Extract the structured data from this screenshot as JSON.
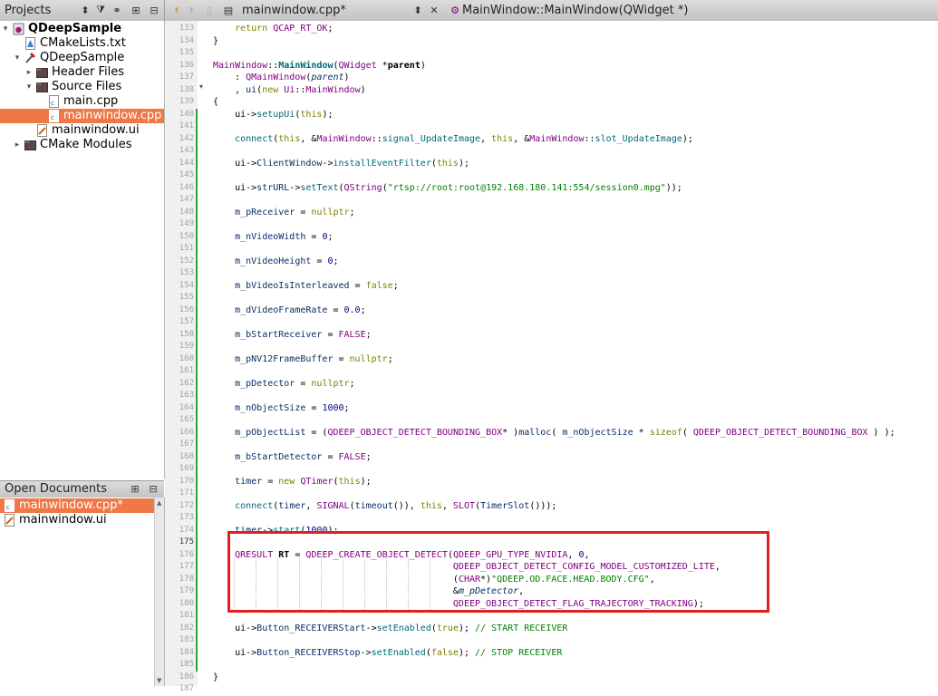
{
  "projects_panel": {
    "title": "Projects"
  },
  "project_tree": [
    {
      "label": "QDeepSample",
      "level": 0,
      "arrow": "▾",
      "icon": "project-icon",
      "bold": true,
      "selected": false
    },
    {
      "label": "CMakeLists.txt",
      "level": 1,
      "arrow": "",
      "icon": "cmake-file-icon",
      "bold": false,
      "selected": false
    },
    {
      "label": "QDeepSample",
      "level": 1,
      "arrow": "▾",
      "icon": "build-target-icon",
      "bold": false,
      "selected": false
    },
    {
      "label": "Header Files",
      "level": 2,
      "arrow": "▸",
      "icon": "folder-icon",
      "bold": false,
      "selected": false
    },
    {
      "label": "Source Files",
      "level": 2,
      "arrow": "▾",
      "icon": "folder-icon",
      "bold": false,
      "selected": false
    },
    {
      "label": "main.cpp",
      "level": 3,
      "arrow": "",
      "icon": "cpp-file-icon",
      "bold": false,
      "selected": false
    },
    {
      "label": "mainwindow.cpp",
      "level": 3,
      "arrow": "",
      "icon": "cpp-file-icon",
      "bold": false,
      "selected": true
    },
    {
      "label": "mainwindow.ui",
      "level": 2,
      "arrow": "",
      "icon": "ui-file-icon",
      "bold": false,
      "selected": false
    },
    {
      "label": "CMake Modules",
      "level": 1,
      "arrow": "▸",
      "icon": "folder-icon",
      "bold": false,
      "selected": false
    }
  ],
  "open_documents": {
    "title": "Open Documents",
    "items": [
      {
        "label": "mainwindow.cpp*",
        "icon": "cpp-file-icon",
        "selected": true
      },
      {
        "label": "mainwindow.ui",
        "icon": "ui-file-icon",
        "selected": false
      }
    ]
  },
  "editor": {
    "file_tab": "mainwindow.cpp*",
    "function_crumb": "MainWindow::MainWindow(QWidget *)",
    "current_line": 175,
    "line_numbers": [
      133,
      134,
      135,
      136,
      137,
      138,
      139,
      140,
      141,
      142,
      143,
      144,
      145,
      146,
      147,
      148,
      149,
      150,
      151,
      152,
      153,
      154,
      155,
      156,
      157,
      158,
      159,
      160,
      161,
      162,
      163,
      164,
      165,
      166,
      167,
      168,
      169,
      170,
      171,
      172,
      173,
      174,
      175,
      176,
      177,
      178,
      179,
      180,
      181,
      182,
      183,
      184,
      185,
      186,
      187
    ],
    "changed_lines": [
      140,
      141,
      142,
      143,
      144,
      145,
      146,
      147,
      148,
      149,
      150,
      151,
      152,
      153,
      154,
      155,
      156,
      157,
      158,
      159,
      160,
      161,
      162,
      163,
      164,
      165,
      166,
      167,
      168,
      169,
      170,
      171,
      172,
      173,
      174,
      175,
      176,
      177,
      178,
      179,
      180,
      181,
      182,
      183,
      184,
      185
    ],
    "lines": [
      [
        [
          "    ",
          ""
        ],
        [
          "return",
          "kw"
        ],
        [
          " ",
          ""
        ],
        [
          "QCAP_RT_OK",
          "macro"
        ],
        [
          ";",
          ""
        ]
      ],
      [
        [
          "}",
          ""
        ]
      ],
      [
        [
          "",
          ""
        ]
      ],
      [
        [
          "MainWindow",
          "cls"
        ],
        [
          "::",
          ""
        ],
        [
          "MainWindow",
          "fnb"
        ],
        [
          "(",
          ""
        ],
        [
          "QWidget",
          "cls"
        ],
        [
          " *",
          ""
        ],
        [
          "parent",
          "bold"
        ],
        [
          ")",
          ""
        ]
      ],
      [
        [
          "    : ",
          ""
        ],
        [
          "QMainWindow",
          "cls"
        ],
        [
          "(",
          ""
        ],
        [
          "parent",
          "it"
        ],
        [
          ")",
          ""
        ]
      ],
      [
        [
          "    , ",
          ""
        ],
        [
          "ui",
          "plain"
        ],
        [
          "(",
          ""
        ],
        [
          "new",
          "kw"
        ],
        [
          " ",
          ""
        ],
        [
          "Ui",
          "cls"
        ],
        [
          "::",
          ""
        ],
        [
          "MainWindow",
          "cls"
        ],
        [
          ")",
          ""
        ]
      ],
      [
        [
          "{",
          ""
        ]
      ],
      [
        [
          "    ui->",
          ""
        ],
        [
          "setupUi",
          "fn"
        ],
        [
          "(",
          ""
        ],
        [
          "this",
          "kw"
        ],
        [
          ");",
          ""
        ]
      ],
      [
        [
          "",
          ""
        ]
      ],
      [
        [
          "    ",
          ""
        ],
        [
          "connect",
          "fn"
        ],
        [
          "(",
          ""
        ],
        [
          "this",
          "kw"
        ],
        [
          ", &",
          ""
        ],
        [
          "MainWindow",
          "cls"
        ],
        [
          "::",
          ""
        ],
        [
          "signal_UpdateImage",
          "fn"
        ],
        [
          ", ",
          ""
        ],
        [
          "this",
          "kw"
        ],
        [
          ", &",
          ""
        ],
        [
          "MainWindow",
          "cls"
        ],
        [
          "::",
          ""
        ],
        [
          "slot_UpdateImage",
          "fn"
        ],
        [
          ");",
          ""
        ]
      ],
      [
        [
          "",
          ""
        ]
      ],
      [
        [
          "    ui->",
          ""
        ],
        [
          "ClientWindow",
          "plain"
        ],
        [
          "->",
          ""
        ],
        [
          "installEventFilter",
          "fn"
        ],
        [
          "(",
          ""
        ],
        [
          "this",
          "kw"
        ],
        [
          ");",
          ""
        ]
      ],
      [
        [
          "",
          ""
        ]
      ],
      [
        [
          "    ui->",
          ""
        ],
        [
          "strURL",
          "plain"
        ],
        [
          "->",
          ""
        ],
        [
          "setText",
          "fn"
        ],
        [
          "(",
          ""
        ],
        [
          "QString",
          "cls"
        ],
        [
          "(",
          ""
        ],
        [
          "\"rtsp://root:root@192.168.180.141:554/session0.mpg\"",
          "str"
        ],
        [
          "));",
          ""
        ]
      ],
      [
        [
          "",
          ""
        ]
      ],
      [
        [
          "    ",
          ""
        ],
        [
          "m_pReceiver",
          "plain"
        ],
        [
          " = ",
          ""
        ],
        [
          "nullptr",
          "kw"
        ],
        [
          ";",
          ""
        ]
      ],
      [
        [
          "",
          ""
        ]
      ],
      [
        [
          "    ",
          ""
        ],
        [
          "m_nVideoWidth",
          "plain"
        ],
        [
          " = ",
          ""
        ],
        [
          "0",
          "num"
        ],
        [
          ";",
          ""
        ]
      ],
      [
        [
          "",
          ""
        ]
      ],
      [
        [
          "    ",
          ""
        ],
        [
          "m_nVideoHeight",
          "plain"
        ],
        [
          " = ",
          ""
        ],
        [
          "0",
          "num"
        ],
        [
          ";",
          ""
        ]
      ],
      [
        [
          "",
          ""
        ]
      ],
      [
        [
          "    ",
          ""
        ],
        [
          "m_bVideoIsInterleaved",
          "plain"
        ],
        [
          " = ",
          ""
        ],
        [
          "false",
          "kw"
        ],
        [
          ";",
          ""
        ]
      ],
      [
        [
          "",
          ""
        ]
      ],
      [
        [
          "    ",
          ""
        ],
        [
          "m_dVideoFrameRate",
          "plain"
        ],
        [
          " = ",
          ""
        ],
        [
          "0.0",
          "num"
        ],
        [
          ";",
          ""
        ]
      ],
      [
        [
          "",
          ""
        ]
      ],
      [
        [
          "    ",
          ""
        ],
        [
          "m_bStartReceiver",
          "plain"
        ],
        [
          " = ",
          ""
        ],
        [
          "FALSE",
          "macro"
        ],
        [
          ";",
          ""
        ]
      ],
      [
        [
          "",
          ""
        ]
      ],
      [
        [
          "    ",
          ""
        ],
        [
          "m_pNV12FrameBuffer",
          "plain"
        ],
        [
          " = ",
          ""
        ],
        [
          "nullptr",
          "kw"
        ],
        [
          ";",
          ""
        ]
      ],
      [
        [
          "",
          ""
        ]
      ],
      [
        [
          "    ",
          ""
        ],
        [
          "m_pDetector",
          "plain"
        ],
        [
          " = ",
          ""
        ],
        [
          "nullptr",
          "kw"
        ],
        [
          ";",
          ""
        ]
      ],
      [
        [
          "",
          ""
        ]
      ],
      [
        [
          "    ",
          ""
        ],
        [
          "m_nObjectSize",
          "plain"
        ],
        [
          " = ",
          ""
        ],
        [
          "1000",
          "num"
        ],
        [
          ";",
          ""
        ]
      ],
      [
        [
          "",
          ""
        ]
      ],
      [
        [
          "    ",
          ""
        ],
        [
          "m_pObjectList",
          "plain"
        ],
        [
          " = (",
          ""
        ],
        [
          "QDEEP_OBJECT_DETECT_BOUNDING_BOX",
          "cls"
        ],
        [
          "* )",
          ""
        ],
        [
          "malloc",
          "plain"
        ],
        [
          "( ",
          ""
        ],
        [
          "m_nObjectSize",
          "plain"
        ],
        [
          " * ",
          ""
        ],
        [
          "sizeof",
          "kw"
        ],
        [
          "( ",
          ""
        ],
        [
          "QDEEP_OBJECT_DETECT_BOUNDING_BOX",
          "cls"
        ],
        [
          " ) );",
          ""
        ]
      ],
      [
        [
          "",
          ""
        ]
      ],
      [
        [
          "    ",
          ""
        ],
        [
          "m_bStartDetector",
          "plain"
        ],
        [
          " = ",
          ""
        ],
        [
          "FALSE",
          "macro"
        ],
        [
          ";",
          ""
        ]
      ],
      [
        [
          "",
          ""
        ]
      ],
      [
        [
          "    ",
          ""
        ],
        [
          "timer",
          "plain"
        ],
        [
          " = ",
          ""
        ],
        [
          "new",
          "kw"
        ],
        [
          " ",
          ""
        ],
        [
          "QTimer",
          "cls"
        ],
        [
          "(",
          ""
        ],
        [
          "this",
          "kw"
        ],
        [
          ");",
          ""
        ]
      ],
      [
        [
          "",
          ""
        ]
      ],
      [
        [
          "    ",
          ""
        ],
        [
          "connect",
          "fn"
        ],
        [
          "(",
          ""
        ],
        [
          "timer",
          "plain"
        ],
        [
          ", ",
          ""
        ],
        [
          "SIGNAL",
          "macro"
        ],
        [
          "(",
          ""
        ],
        [
          "timeout",
          "plain"
        ],
        [
          "()), ",
          ""
        ],
        [
          "this",
          "kw"
        ],
        [
          ", ",
          ""
        ],
        [
          "SLOT",
          "macro"
        ],
        [
          "(",
          ""
        ],
        [
          "TimerSlot",
          "plain"
        ],
        [
          "()));",
          ""
        ]
      ],
      [
        [
          "",
          ""
        ]
      ],
      [
        [
          "    ",
          ""
        ],
        [
          "timer",
          "plain"
        ],
        [
          "->",
          ""
        ],
        [
          "start",
          "fn"
        ],
        [
          "(",
          ""
        ],
        [
          "1000",
          "num"
        ],
        [
          ");",
          ""
        ]
      ],
      [
        [
          "",
          ""
        ]
      ],
      [
        [
          "    ",
          ""
        ],
        [
          "QRESULT",
          "cls"
        ],
        [
          " ",
          ""
        ],
        [
          "RT",
          "bold"
        ],
        [
          " = ",
          ""
        ],
        [
          "QDEEP_CREATE_OBJECT_DETECT",
          "macro"
        ],
        [
          "(",
          ""
        ],
        [
          "QDEEP_GPU_TYPE_NVIDIA",
          "macro"
        ],
        [
          ", ",
          ""
        ],
        [
          "0",
          "num"
        ],
        [
          ",",
          ""
        ]
      ],
      [
        [
          "                                            ",
          ""
        ],
        [
          "QDEEP_OBJECT_DETECT_CONFIG_MODEL_CUSTOMIZED_LITE",
          "macro"
        ],
        [
          ",",
          ""
        ]
      ],
      [
        [
          "                                            (",
          ""
        ],
        [
          "CHAR",
          "macro"
        ],
        [
          "*)",
          ""
        ],
        [
          "\"QDEEP.OD.FACE.HEAD.BODY.CFG\"",
          "str"
        ],
        [
          ",",
          ""
        ]
      ],
      [
        [
          "                                            &",
          ""
        ],
        [
          "m_pDetector",
          "it"
        ],
        [
          ",",
          ""
        ]
      ],
      [
        [
          "                                            ",
          ""
        ],
        [
          "QDEEP_OBJECT_DETECT_FLAG_TRAJECTORY_TRACKING",
          "macro"
        ],
        [
          ");",
          ""
        ]
      ],
      [
        [
          "",
          ""
        ]
      ],
      [
        [
          "    ui->",
          ""
        ],
        [
          "Button_RECEIVERStart",
          "plain"
        ],
        [
          "->",
          ""
        ],
        [
          "setEnabled",
          "fn"
        ],
        [
          "(",
          ""
        ],
        [
          "true",
          "kw"
        ],
        [
          "); ",
          ""
        ],
        [
          "// START RECEIVER",
          "cmt"
        ]
      ],
      [
        [
          "",
          ""
        ]
      ],
      [
        [
          "    ui->",
          ""
        ],
        [
          "Button_RECEIVERStop",
          "plain"
        ],
        [
          "->",
          ""
        ],
        [
          "setEnabled",
          "fn"
        ],
        [
          "(",
          ""
        ],
        [
          "false",
          "kw"
        ],
        [
          "); ",
          ""
        ],
        [
          "// STOP RECEIVER",
          "cmt"
        ]
      ],
      [
        [
          "",
          ""
        ]
      ],
      [
        [
          "}",
          ""
        ]
      ]
    ]
  },
  "colors": {
    "kw": "#808000",
    "macro": "#800080",
    "cls": "#800080",
    "fn": "#00677c",
    "fnb": "#00677c",
    "str": "#008000",
    "num": "#000080",
    "cmt": "#008000",
    "plain": "#092e64",
    "it": "#092e64",
    "bold": "#000000",
    "selection": "#f07746",
    "highlight": "#e02020"
  }
}
